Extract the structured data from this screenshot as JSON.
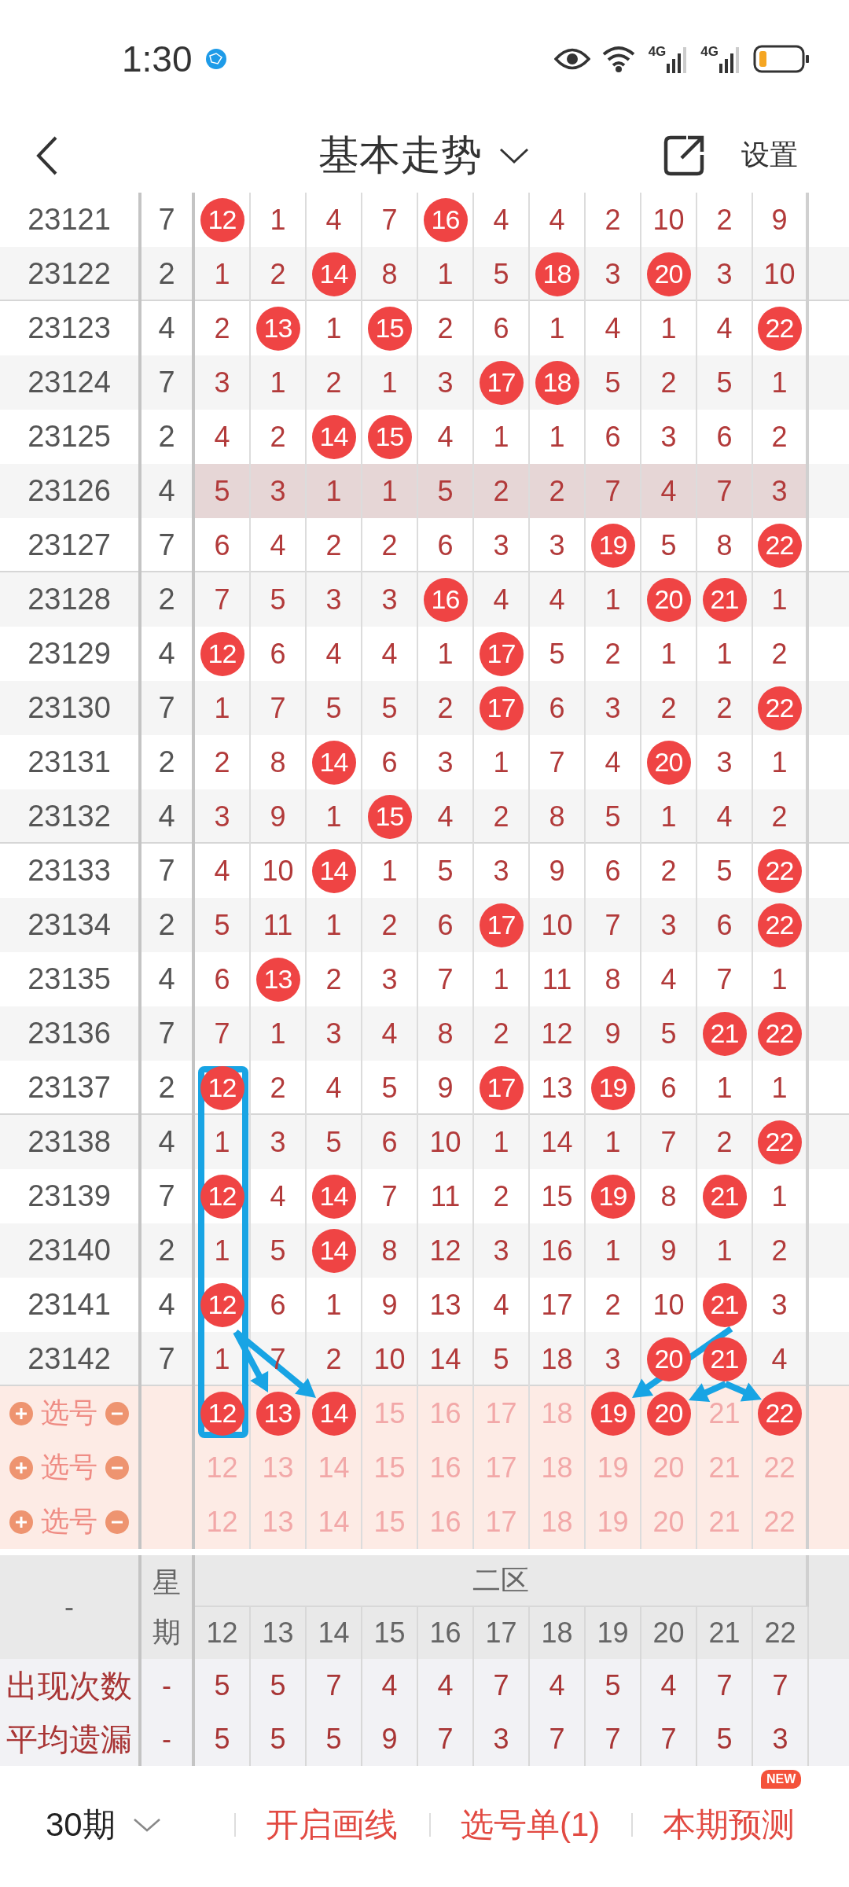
{
  "status_bar": {
    "time": "1:30",
    "network_labels": [
      "4G",
      "4G"
    ]
  },
  "header": {
    "title": "基本走势",
    "action": "设置"
  },
  "table": {
    "rows": [
      {
        "issue": "23121",
        "weekday": "7",
        "highlighted": false,
        "cells": [
          {
            "value": "12",
            "hit": true
          },
          {
            "value": "1",
            "hit": false
          },
          {
            "value": "4",
            "hit": false
          },
          {
            "value": "7",
            "hit": false
          },
          {
            "value": "16",
            "hit": true
          },
          {
            "value": "4",
            "hit": false
          },
          {
            "value": "4",
            "hit": false
          },
          {
            "value": "2",
            "hit": false
          },
          {
            "value": "10",
            "hit": false
          },
          {
            "value": "2",
            "hit": false
          },
          {
            "value": "9",
            "hit": false
          }
        ]
      },
      {
        "issue": "23122",
        "weekday": "2",
        "highlighted": false,
        "cells": [
          {
            "value": "1",
            "hit": false
          },
          {
            "value": "2",
            "hit": false
          },
          {
            "value": "14",
            "hit": true
          },
          {
            "value": "8",
            "hit": false
          },
          {
            "value": "1",
            "hit": false
          },
          {
            "value": "5",
            "hit": false
          },
          {
            "value": "18",
            "hit": true
          },
          {
            "value": "3",
            "hit": false
          },
          {
            "value": "20",
            "hit": true
          },
          {
            "value": "3",
            "hit": false
          },
          {
            "value": "10",
            "hit": false
          }
        ]
      },
      {
        "issue": "23123",
        "weekday": "4",
        "highlighted": false,
        "cells": [
          {
            "value": "2",
            "hit": false
          },
          {
            "value": "13",
            "hit": true
          },
          {
            "value": "1",
            "hit": false
          },
          {
            "value": "15",
            "hit": true
          },
          {
            "value": "2",
            "hit": false
          },
          {
            "value": "6",
            "hit": false
          },
          {
            "value": "1",
            "hit": false
          },
          {
            "value": "4",
            "hit": false
          },
          {
            "value": "1",
            "hit": false
          },
          {
            "value": "4",
            "hit": false
          },
          {
            "value": "22",
            "hit": true
          }
        ]
      },
      {
        "issue": "23124",
        "weekday": "7",
        "highlighted": false,
        "cells": [
          {
            "value": "3",
            "hit": false
          },
          {
            "value": "1",
            "hit": false
          },
          {
            "value": "2",
            "hit": false
          },
          {
            "value": "1",
            "hit": false
          },
          {
            "value": "3",
            "hit": false
          },
          {
            "value": "17",
            "hit": true
          },
          {
            "value": "18",
            "hit": true
          },
          {
            "value": "5",
            "hit": false
          },
          {
            "value": "2",
            "hit": false
          },
          {
            "value": "5",
            "hit": false
          },
          {
            "value": "1",
            "hit": false
          }
        ]
      },
      {
        "issue": "23125",
        "weekday": "2",
        "highlighted": false,
        "cells": [
          {
            "value": "4",
            "hit": false
          },
          {
            "value": "2",
            "hit": false
          },
          {
            "value": "14",
            "hit": true
          },
          {
            "value": "15",
            "hit": true
          },
          {
            "value": "4",
            "hit": false
          },
          {
            "value": "1",
            "hit": false
          },
          {
            "value": "1",
            "hit": false
          },
          {
            "value": "6",
            "hit": false
          },
          {
            "value": "3",
            "hit": false
          },
          {
            "value": "6",
            "hit": false
          },
          {
            "value": "2",
            "hit": false
          }
        ]
      },
      {
        "issue": "23126",
        "weekday": "4",
        "highlighted": true,
        "cells": [
          {
            "value": "5",
            "hit": false
          },
          {
            "value": "3",
            "hit": false
          },
          {
            "value": "1",
            "hit": false
          },
          {
            "value": "1",
            "hit": false
          },
          {
            "value": "5",
            "hit": false
          },
          {
            "value": "2",
            "hit": false
          },
          {
            "value": "2",
            "hit": false
          },
          {
            "value": "7",
            "hit": false
          },
          {
            "value": "4",
            "hit": false
          },
          {
            "value": "7",
            "hit": false
          },
          {
            "value": "3",
            "hit": false
          }
        ]
      },
      {
        "issue": "23127",
        "weekday": "7",
        "highlighted": false,
        "cells": [
          {
            "value": "6",
            "hit": false
          },
          {
            "value": "4",
            "hit": false
          },
          {
            "value": "2",
            "hit": false
          },
          {
            "value": "2",
            "hit": false
          },
          {
            "value": "6",
            "hit": false
          },
          {
            "value": "3",
            "hit": false
          },
          {
            "value": "3",
            "hit": false
          },
          {
            "value": "19",
            "hit": true
          },
          {
            "value": "5",
            "hit": false
          },
          {
            "value": "8",
            "hit": false
          },
          {
            "value": "22",
            "hit": true
          }
        ]
      },
      {
        "issue": "23128",
        "weekday": "2",
        "highlighted": false,
        "cells": [
          {
            "value": "7",
            "hit": false
          },
          {
            "value": "5",
            "hit": false
          },
          {
            "value": "3",
            "hit": false
          },
          {
            "value": "3",
            "hit": false
          },
          {
            "value": "16",
            "hit": true
          },
          {
            "value": "4",
            "hit": false
          },
          {
            "value": "4",
            "hit": false
          },
          {
            "value": "1",
            "hit": false
          },
          {
            "value": "20",
            "hit": true
          },
          {
            "value": "21",
            "hit": true
          },
          {
            "value": "1",
            "hit": false
          }
        ]
      },
      {
        "issue": "23129",
        "weekday": "4",
        "highlighted": false,
        "cells": [
          {
            "value": "12",
            "hit": true
          },
          {
            "value": "6",
            "hit": false
          },
          {
            "value": "4",
            "hit": false
          },
          {
            "value": "4",
            "hit": false
          },
          {
            "value": "1",
            "hit": false
          },
          {
            "value": "17",
            "hit": true
          },
          {
            "value": "5",
            "hit": false
          },
          {
            "value": "2",
            "hit": false
          },
          {
            "value": "1",
            "hit": false
          },
          {
            "value": "1",
            "hit": false
          },
          {
            "value": "2",
            "hit": false
          }
        ]
      },
      {
        "issue": "23130",
        "weekday": "7",
        "highlighted": false,
        "cells": [
          {
            "value": "1",
            "hit": false
          },
          {
            "value": "7",
            "hit": false
          },
          {
            "value": "5",
            "hit": false
          },
          {
            "value": "5",
            "hit": false
          },
          {
            "value": "2",
            "hit": false
          },
          {
            "value": "17",
            "hit": true
          },
          {
            "value": "6",
            "hit": false
          },
          {
            "value": "3",
            "hit": false
          },
          {
            "value": "2",
            "hit": false
          },
          {
            "value": "2",
            "hit": false
          },
          {
            "value": "22",
            "hit": true
          }
        ]
      },
      {
        "issue": "23131",
        "weekday": "2",
        "highlighted": false,
        "cells": [
          {
            "value": "2",
            "hit": false
          },
          {
            "value": "8",
            "hit": false
          },
          {
            "value": "14",
            "hit": true
          },
          {
            "value": "6",
            "hit": false
          },
          {
            "value": "3",
            "hit": false
          },
          {
            "value": "1",
            "hit": false
          },
          {
            "value": "7",
            "hit": false
          },
          {
            "value": "4",
            "hit": false
          },
          {
            "value": "20",
            "hit": true
          },
          {
            "value": "3",
            "hit": false
          },
          {
            "value": "1",
            "hit": false
          }
        ]
      },
      {
        "issue": "23132",
        "weekday": "4",
        "highlighted": false,
        "cells": [
          {
            "value": "3",
            "hit": false
          },
          {
            "value": "9",
            "hit": false
          },
          {
            "value": "1",
            "hit": false
          },
          {
            "value": "15",
            "hit": true
          },
          {
            "value": "4",
            "hit": false
          },
          {
            "value": "2",
            "hit": false
          },
          {
            "value": "8",
            "hit": false
          },
          {
            "value": "5",
            "hit": false
          },
          {
            "value": "1",
            "hit": false
          },
          {
            "value": "4",
            "hit": false
          },
          {
            "value": "2",
            "hit": false
          }
        ]
      },
      {
        "issue": "23133",
        "weekday": "7",
        "highlighted": false,
        "cells": [
          {
            "value": "4",
            "hit": false
          },
          {
            "value": "10",
            "hit": false
          },
          {
            "value": "14",
            "hit": true
          },
          {
            "value": "1",
            "hit": false
          },
          {
            "value": "5",
            "hit": false
          },
          {
            "value": "3",
            "hit": false
          },
          {
            "value": "9",
            "hit": false
          },
          {
            "value": "6",
            "hit": false
          },
          {
            "value": "2",
            "hit": false
          },
          {
            "value": "5",
            "hit": false
          },
          {
            "value": "22",
            "hit": true
          }
        ]
      },
      {
        "issue": "23134",
        "weekday": "2",
        "highlighted": false,
        "cells": [
          {
            "value": "5",
            "hit": false
          },
          {
            "value": "11",
            "hit": false
          },
          {
            "value": "1",
            "hit": false
          },
          {
            "value": "2",
            "hit": false
          },
          {
            "value": "6",
            "hit": false
          },
          {
            "value": "17",
            "hit": true
          },
          {
            "value": "10",
            "hit": false
          },
          {
            "value": "7",
            "hit": false
          },
          {
            "value": "3",
            "hit": false
          },
          {
            "value": "6",
            "hit": false
          },
          {
            "value": "22",
            "hit": true
          }
        ]
      },
      {
        "issue": "23135",
        "weekday": "4",
        "highlighted": false,
        "cells": [
          {
            "value": "6",
            "hit": false
          },
          {
            "value": "13",
            "hit": true
          },
          {
            "value": "2",
            "hit": false
          },
          {
            "value": "3",
            "hit": false
          },
          {
            "value": "7",
            "hit": false
          },
          {
            "value": "1",
            "hit": false
          },
          {
            "value": "11",
            "hit": false
          },
          {
            "value": "8",
            "hit": false
          },
          {
            "value": "4",
            "hit": false
          },
          {
            "value": "7",
            "hit": false
          },
          {
            "value": "1",
            "hit": false
          }
        ]
      },
      {
        "issue": "23136",
        "weekday": "7",
        "highlighted": false,
        "cells": [
          {
            "value": "7",
            "hit": false
          },
          {
            "value": "1",
            "hit": false
          },
          {
            "value": "3",
            "hit": false
          },
          {
            "value": "4",
            "hit": false
          },
          {
            "value": "8",
            "hit": false
          },
          {
            "value": "2",
            "hit": false
          },
          {
            "value": "12",
            "hit": false
          },
          {
            "value": "9",
            "hit": false
          },
          {
            "value": "5",
            "hit": false
          },
          {
            "value": "21",
            "hit": true
          },
          {
            "value": "22",
            "hit": true
          }
        ]
      },
      {
        "issue": "23137",
        "weekday": "2",
        "highlighted": false,
        "cells": [
          {
            "value": "12",
            "hit": true
          },
          {
            "value": "2",
            "hit": false
          },
          {
            "value": "4",
            "hit": false
          },
          {
            "value": "5",
            "hit": false
          },
          {
            "value": "9",
            "hit": false
          },
          {
            "value": "17",
            "hit": true
          },
          {
            "value": "13",
            "hit": false
          },
          {
            "value": "19",
            "hit": true
          },
          {
            "value": "6",
            "hit": false
          },
          {
            "value": "1",
            "hit": false
          },
          {
            "value": "1",
            "hit": false
          }
        ]
      },
      {
        "issue": "23138",
        "weekday": "4",
        "highlighted": false,
        "cells": [
          {
            "value": "1",
            "hit": false
          },
          {
            "value": "3",
            "hit": false
          },
          {
            "value": "5",
            "hit": false
          },
          {
            "value": "6",
            "hit": false
          },
          {
            "value": "10",
            "hit": false
          },
          {
            "value": "1",
            "hit": false
          },
          {
            "value": "14",
            "hit": false
          },
          {
            "value": "1",
            "hit": false
          },
          {
            "value": "7",
            "hit": false
          },
          {
            "value": "2",
            "hit": false
          },
          {
            "value": "22",
            "hit": true
          }
        ]
      },
      {
        "issue": "23139",
        "weekday": "7",
        "highlighted": false,
        "cells": [
          {
            "value": "12",
            "hit": true
          },
          {
            "value": "4",
            "hit": false
          },
          {
            "value": "14",
            "hit": true
          },
          {
            "value": "7",
            "hit": false
          },
          {
            "value": "11",
            "hit": false
          },
          {
            "value": "2",
            "hit": false
          },
          {
            "value": "15",
            "hit": false
          },
          {
            "value": "19",
            "hit": true
          },
          {
            "value": "8",
            "hit": false
          },
          {
            "value": "21",
            "hit": true
          },
          {
            "value": "1",
            "hit": false
          }
        ]
      },
      {
        "issue": "23140",
        "weekday": "2",
        "highlighted": false,
        "cells": [
          {
            "value": "1",
            "hit": false
          },
          {
            "value": "5",
            "hit": false
          },
          {
            "value": "14",
            "hit": true
          },
          {
            "value": "8",
            "hit": false
          },
          {
            "value": "12",
            "hit": false
          },
          {
            "value": "3",
            "hit": false
          },
          {
            "value": "16",
            "hit": false
          },
          {
            "value": "1",
            "hit": false
          },
          {
            "value": "9",
            "hit": false
          },
          {
            "value": "1",
            "hit": false
          },
          {
            "value": "2",
            "hit": false
          }
        ]
      },
      {
        "issue": "23141",
        "weekday": "4",
        "highlighted": false,
        "cells": [
          {
            "value": "12",
            "hit": true
          },
          {
            "value": "6",
            "hit": false
          },
          {
            "value": "1",
            "hit": false
          },
          {
            "value": "9",
            "hit": false
          },
          {
            "value": "13",
            "hit": false
          },
          {
            "value": "4",
            "hit": false
          },
          {
            "value": "17",
            "hit": false
          },
          {
            "value": "2",
            "hit": false
          },
          {
            "value": "10",
            "hit": false
          },
          {
            "value": "21",
            "hit": true
          },
          {
            "value": "3",
            "hit": false
          }
        ]
      },
      {
        "issue": "23142",
        "weekday": "7",
        "highlighted": false,
        "cells": [
          {
            "value": "1",
            "hit": false
          },
          {
            "value": "7",
            "hit": false
          },
          {
            "value": "2",
            "hit": false
          },
          {
            "value": "10",
            "hit": false
          },
          {
            "value": "14",
            "hit": false
          },
          {
            "value": "5",
            "hit": false
          },
          {
            "value": "18",
            "hit": false
          },
          {
            "value": "3",
            "hit": false
          },
          {
            "value": "20",
            "hit": true
          },
          {
            "value": "21",
            "hit": true
          },
          {
            "value": "4",
            "hit": false
          }
        ]
      }
    ],
    "pick_rows": [
      {
        "label": "选号",
        "numbers": [
          {
            "value": "12",
            "selected": true
          },
          {
            "value": "13",
            "selected": true
          },
          {
            "value": "14",
            "selected": true
          },
          {
            "value": "15",
            "selected": false
          },
          {
            "value": "16",
            "selected": false
          },
          {
            "value": "17",
            "selected": false
          },
          {
            "value": "18",
            "selected": false
          },
          {
            "value": "19",
            "selected": true
          },
          {
            "value": "20",
            "selected": true
          },
          {
            "value": "21",
            "selected": false
          },
          {
            "value": "22",
            "selected": true
          }
        ]
      },
      {
        "label": "选号",
        "numbers": [
          {
            "value": "12",
            "selected": false
          },
          {
            "value": "13",
            "selected": false
          },
          {
            "value": "14",
            "selected": false
          },
          {
            "value": "15",
            "selected": false
          },
          {
            "value": "16",
            "selected": false
          },
          {
            "value": "17",
            "selected": false
          },
          {
            "value": "18",
            "selected": false
          },
          {
            "value": "19",
            "selected": false
          },
          {
            "value": "20",
            "selected": false
          },
          {
            "value": "21",
            "selected": false
          },
          {
            "value": "22",
            "selected": false
          }
        ]
      },
      {
        "label": "选号",
        "numbers": [
          {
            "value": "12",
            "selected": false
          },
          {
            "value": "13",
            "selected": false
          },
          {
            "value": "14",
            "selected": false
          },
          {
            "value": "15",
            "selected": false
          },
          {
            "value": "16",
            "selected": false
          },
          {
            "value": "17",
            "selected": false
          },
          {
            "value": "18",
            "selected": false
          },
          {
            "value": "19",
            "selected": false
          },
          {
            "value": "20",
            "selected": false
          },
          {
            "value": "21",
            "selected": false
          },
          {
            "value": "22",
            "selected": false
          }
        ]
      }
    ],
    "footer": {
      "issue_header": "-",
      "weekday_header": "星期",
      "zone": "二区",
      "numbers": [
        "12",
        "13",
        "14",
        "15",
        "16",
        "17",
        "18",
        "19",
        "20",
        "21",
        "22"
      ],
      "stats": [
        {
          "label": "出现次数",
          "weekday": "-",
          "values": [
            "5",
            "5",
            "7",
            "4",
            "4",
            "7",
            "4",
            "5",
            "4",
            "7",
            "7"
          ]
        },
        {
          "label": "平均遗漏",
          "weekday": "-",
          "values": [
            "5",
            "5",
            "5",
            "9",
            "7",
            "3",
            "7",
            "7",
            "7",
            "5",
            "3"
          ]
        }
      ]
    }
  },
  "bottom_bar": {
    "period": "30期",
    "actions": [
      {
        "label": "开启画线"
      },
      {
        "label": "选号单(1)"
      },
      {
        "label": "本期预测",
        "badge": "NEW"
      }
    ]
  }
}
